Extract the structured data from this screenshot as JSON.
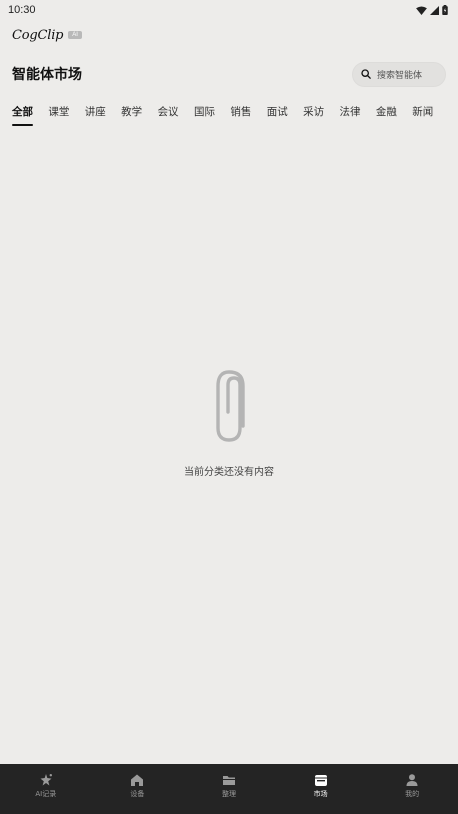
{
  "status": {
    "time": "10:30"
  },
  "app": {
    "logo": "CogClip",
    "badge": "AI"
  },
  "header": {
    "title": "智能体市场",
    "search_placeholder": "搜索智能体"
  },
  "tabs": [
    {
      "label": "全部",
      "active": true
    },
    {
      "label": "课堂"
    },
    {
      "label": "讲座"
    },
    {
      "label": "教学"
    },
    {
      "label": "会议"
    },
    {
      "label": "国际"
    },
    {
      "label": "销售"
    },
    {
      "label": "面试"
    },
    {
      "label": "采访"
    },
    {
      "label": "法律"
    },
    {
      "label": "金融"
    },
    {
      "label": "新闻"
    }
  ],
  "empty": {
    "message": "当前分类还没有内容",
    "icon": "paperclip-icon"
  },
  "nav": [
    {
      "label": "AI记录",
      "icon": "ai-sparkle-icon"
    },
    {
      "label": "设备",
      "icon": "home-icon"
    },
    {
      "label": "整理",
      "icon": "folder-icon"
    },
    {
      "label": "市场",
      "icon": "market-icon",
      "active": true
    },
    {
      "label": "我的",
      "icon": "person-icon"
    }
  ],
  "colors": {
    "background": "#edecea",
    "nav_bg": "#242424",
    "active": "#111111"
  }
}
